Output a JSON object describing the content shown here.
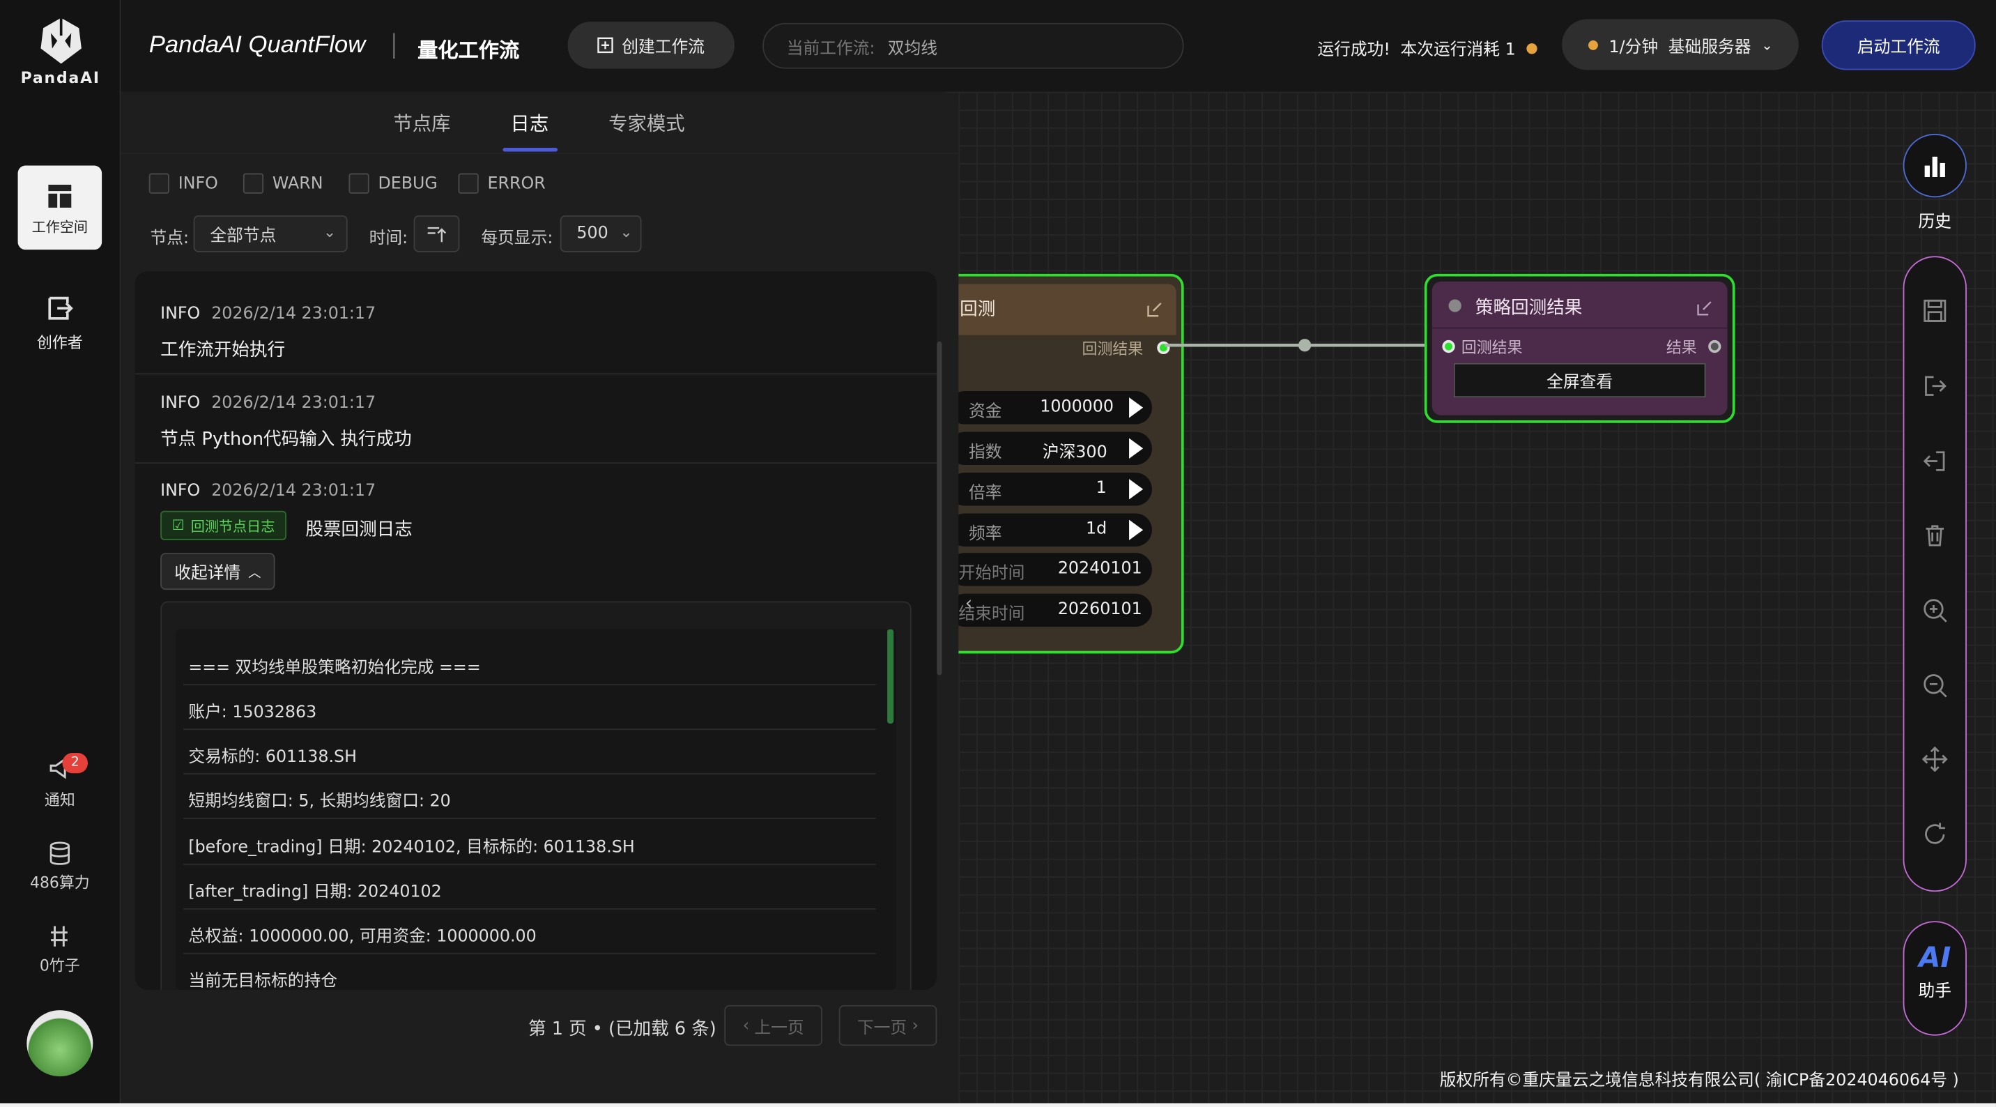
{
  "brand": {
    "logo_text": "PandaAI",
    "app_name": "PandaAI QuantFlow",
    "section_title": "量化工作流"
  },
  "header": {
    "create_button": "创建工作流",
    "current_workflow_label": "当前工作流:",
    "current_workflow_name": "双均线",
    "run_status": "运行成功!",
    "run_cost_label": "本次运行消耗 1",
    "server_rate": "1/分钟",
    "server_name": "基础服务器",
    "start_button": "启动工作流"
  },
  "sidebar": {
    "items": [
      {
        "label": "工作空间",
        "icon": "workspace-icon",
        "active": true
      },
      {
        "label": "创作者",
        "icon": "creator-icon",
        "active": false
      }
    ],
    "bottom": [
      {
        "label": "通知",
        "badge": "2",
        "icon": "megaphone-icon"
      },
      {
        "label": "486算力",
        "icon": "database-icon"
      },
      {
        "label": "0竹子",
        "icon": "bamboo-icon"
      }
    ]
  },
  "panel": {
    "tabs": [
      "节点库",
      "日志",
      "专家模式"
    ],
    "active_tab": "日志",
    "levels": [
      "INFO",
      "WARN",
      "DEBUG",
      "ERROR"
    ],
    "node_label": "节点:",
    "node_value": "全部节点",
    "time_label": "时间:",
    "per_page_label": "每页显示:",
    "per_page_value": "500"
  },
  "logs": [
    {
      "level": "INFO",
      "time": "2026/2/14 23:01:17",
      "message": "工作流开始执行"
    },
    {
      "level": "INFO",
      "time": "2026/2/14 23:01:17",
      "message": "节点 Python代码输入 执行成功"
    },
    {
      "level": "INFO",
      "time": "2026/2/14 23:01:17",
      "tag": "回测节点日志",
      "message": "股票回测日志",
      "collapse_label": "收起详情"
    }
  ],
  "detail_lines": [
    "=== 双均线单股策略初始化完成 ===",
    "账户: 15032863",
    "交易标的: 601138.SH",
    "短期均线窗口: 5, 长期均线窗口: 20",
    "[before_trading] 日期: 20240102, 目标标的: 601138.SH",
    "[after_trading] 日期: 20240102",
    "总权益: 1000000.00, 可用资金: 1000000.00",
    "当前无目标标的持仓"
  ],
  "pagination": {
    "page_info": "第 1 页 • (已加载 6 条)",
    "prev": "上一页",
    "next": "下一页"
  },
  "node_left": {
    "title": "回测",
    "output_label": "回测结果",
    "params": [
      {
        "label": "资金",
        "value": "1000000"
      },
      {
        "label": "指数",
        "value": "沪深300"
      },
      {
        "label": "倍率",
        "value": "1"
      },
      {
        "label": "频率",
        "value": "1d"
      },
      {
        "label": "开始时间",
        "value": "20240101"
      },
      {
        "label": "结束时间",
        "value": "20260101"
      }
    ]
  },
  "node_right": {
    "title": "策略回测结果",
    "input_label": "回测结果",
    "output_label": "结果",
    "button": "全屏查看"
  },
  "right_tools": {
    "history_label": "历史",
    "ai_label": "AI",
    "assistant_label": "助手"
  },
  "footer": {
    "copyright": "版权所有©重庆量云之境信息科技有限公司( 渝ICP备2024046064号 )"
  },
  "colors": {
    "accent_green": "#2de02d",
    "start_button": "#1d2a78",
    "node_right_bg": "#4b2a4a",
    "node_left_bg": "#5a4630"
  }
}
